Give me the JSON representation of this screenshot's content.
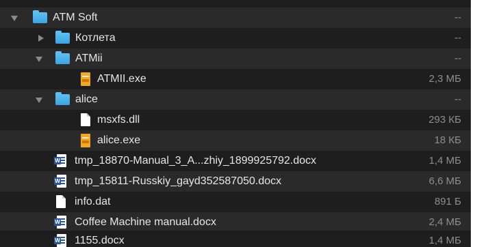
{
  "file_list": {
    "rows": [
      {
        "name": "ATM Soft",
        "size": "--",
        "kind": "folder",
        "expanded": true
      },
      {
        "name": "Котлета",
        "size": "--",
        "kind": "folder",
        "expanded": false
      },
      {
        "name": "ATMii",
        "size": "--",
        "kind": "folder",
        "expanded": true
      },
      {
        "name": "ATMII.exe",
        "size": "2,3 МБ",
        "kind": "executable"
      },
      {
        "name": "alice",
        "size": "--",
        "kind": "folder",
        "expanded": true
      },
      {
        "name": "msxfs.dll",
        "size": "293 КБ",
        "kind": "document"
      },
      {
        "name": "alice.exe",
        "size": "18 КБ",
        "kind": "executable"
      },
      {
        "name": "tmp_18870-Manual_3_A...zhiy_1899925792.docx",
        "size": "1,4 МБ",
        "kind": "word"
      },
      {
        "name": "tmp_15811-Russkiy_gayd352587050.docx",
        "size": "6,6 МБ",
        "kind": "word"
      },
      {
        "name": "info.dat",
        "size": "891 Б",
        "kind": "document"
      },
      {
        "name": "Coffee Machine manual.docx",
        "size": "2,4 МБ",
        "kind": "word"
      },
      {
        "name": "1155.docx",
        "size": "1,4 МБ",
        "kind": "word"
      }
    ],
    "icons": {
      "folder": "folder-icon",
      "executable": "executable-icon",
      "document": "document-icon",
      "word": "word-document-icon",
      "disclosure_open": "disclosure-triangle-down-icon",
      "disclosure_closed": "disclosure-triangle-right-icon"
    },
    "colors": {
      "background": "#1e1e1e",
      "row_alt": "#2a2a2a",
      "text": "#e6e6e6",
      "size_text": "#8e8e8e",
      "folder": "#4ab2ec",
      "executable": "#f5a623",
      "word": "#2b579a"
    }
  }
}
